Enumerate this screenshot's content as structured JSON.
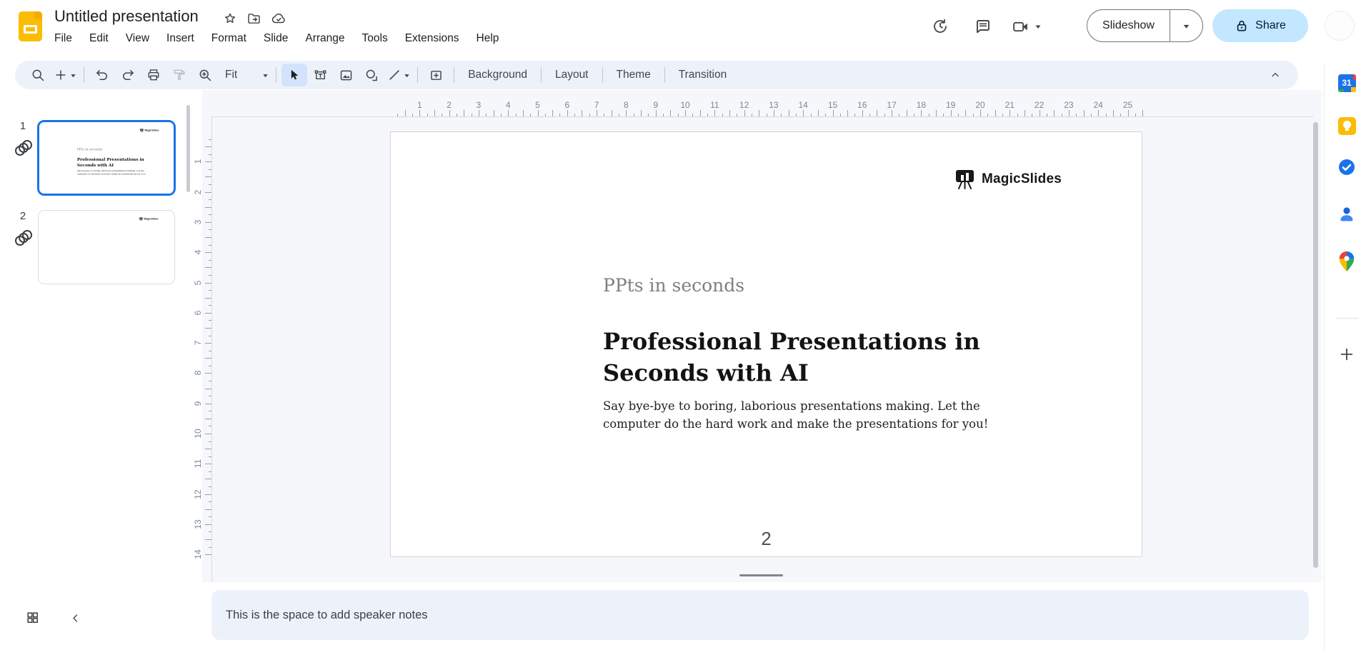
{
  "header": {
    "doc_title": "Untitled presentation",
    "menu_items": [
      "File",
      "Edit",
      "View",
      "Insert",
      "Format",
      "Slide",
      "Arrange",
      "Tools",
      "Extensions",
      "Help"
    ],
    "slideshow_label": "Slideshow",
    "share_label": "Share"
  },
  "toolbar": {
    "zoom_value": "Fit",
    "background_label": "Background",
    "layout_label": "Layout",
    "theme_label": "Theme",
    "transition_label": "Transition"
  },
  "filmstrip": {
    "slide1_number": "1",
    "slide2_number": "2"
  },
  "rulers": {
    "horizontal_numbers": [
      "1",
      "2",
      "3",
      "4",
      "5",
      "6",
      "7",
      "8",
      "9",
      "10",
      "11",
      "12",
      "13",
      "14",
      "15",
      "16",
      "17",
      "18",
      "19",
      "20",
      "21",
      "22",
      "23",
      "24",
      "25"
    ],
    "vertical_numbers": [
      "1",
      "2",
      "3",
      "4",
      "5",
      "6",
      "7",
      "8",
      "9",
      "10",
      "11",
      "12",
      "13",
      "14"
    ]
  },
  "slide": {
    "brand_name": "MagicSlides",
    "kicker": "PPts in seconds",
    "title": "Professional Presentations in Seconds with AI",
    "body": "Say bye-bye to boring, laborious presentations making. Let the computer do the hard work and make the presentations for you!",
    "page_number": "2"
  },
  "notes": {
    "placeholder": "This is the space to add speaker notes"
  },
  "colors": {
    "accent_blue": "#1a73e8",
    "selected_thumb_border": "#1a73e8",
    "share_bg": "#c2e7ff",
    "share_text": "#001d35",
    "toolbar_bg": "#edf2fa",
    "selected_tool_bg": "#d3e3fd",
    "slides_logo_yellow": "#fbbc04",
    "notes_bg": "#edf2fa",
    "canvas_bg": "#f5f7fa"
  }
}
